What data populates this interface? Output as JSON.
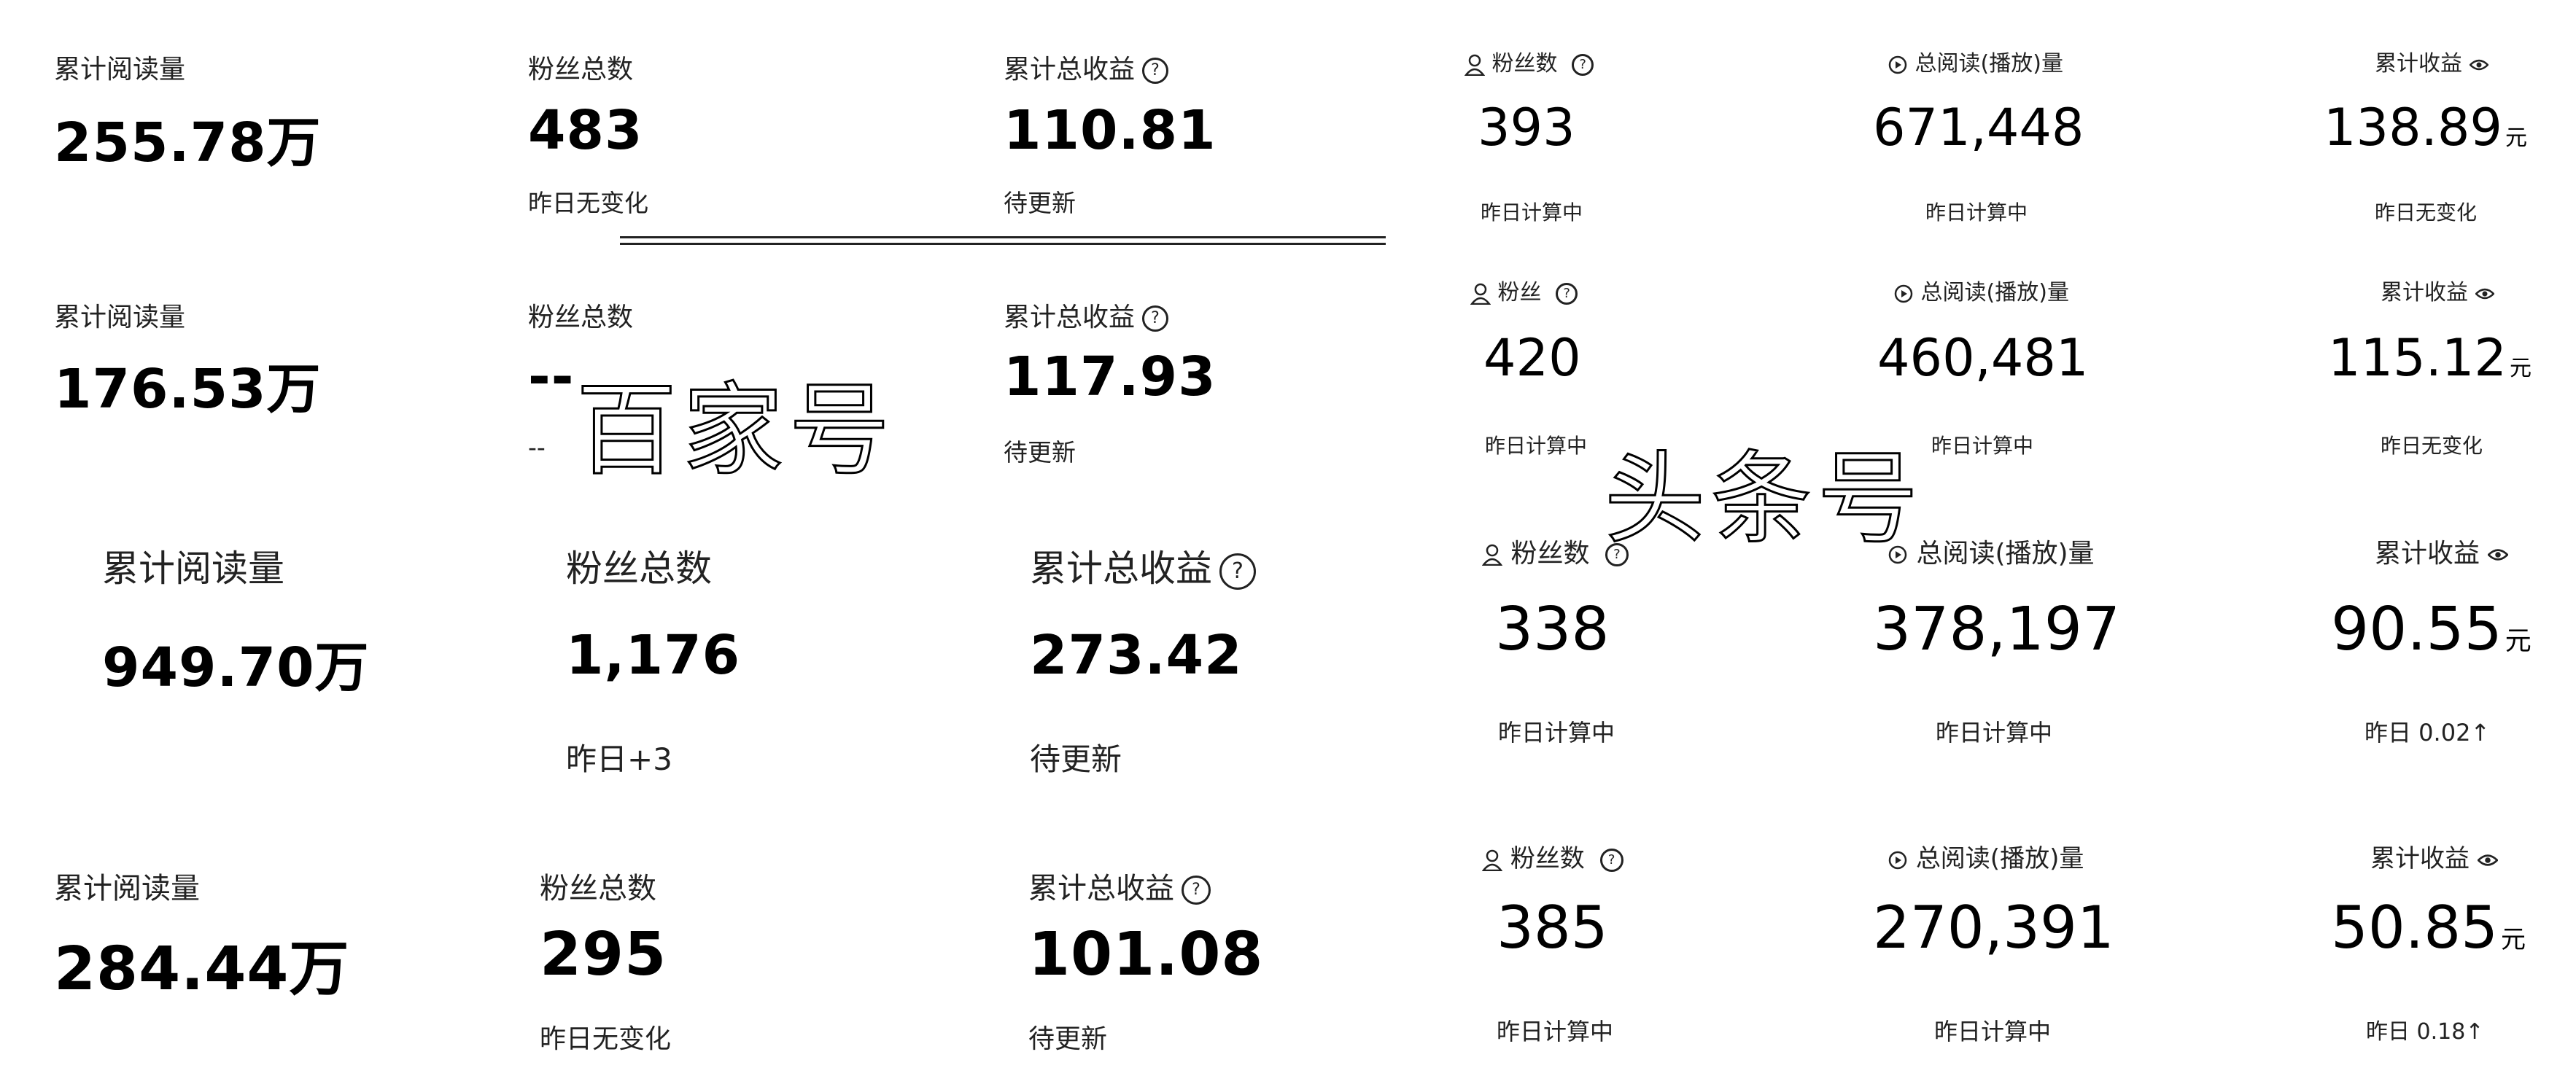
{
  "watermarks": {
    "left": "百家号",
    "right": "头条号"
  },
  "baijiahao_cards": [
    {
      "read_label": "累计阅读量",
      "read_value": "255.78万",
      "fans_label": "粉丝总数",
      "fans_value": "483",
      "fans_sub": "昨日无变化",
      "income_label": "累计总收益",
      "income_value": "110.81",
      "income_sub": "待更新"
    },
    {
      "read_label": "累计阅读量",
      "read_value": "176.53万",
      "fans_label": "粉丝总数",
      "fans_value": "--",
      "fans_sub": "--",
      "income_label": "累计总收益",
      "income_value": "117.93",
      "income_sub": "待更新"
    },
    {
      "read_label": "累计阅读量",
      "read_value": "949.70万",
      "fans_label": "粉丝总数",
      "fans_value": "1,176",
      "fans_sub": "昨日+3",
      "income_label": "累计总收益",
      "income_value": "273.42",
      "income_sub": "待更新"
    },
    {
      "read_label": "累计阅读量",
      "read_value": "284.44万",
      "fans_label": "粉丝总数",
      "fans_value": "295",
      "fans_sub": "昨日无变化",
      "income_label": "累计总收益",
      "income_value": "101.08",
      "income_sub": "待更新"
    }
  ],
  "toutiao_cards": [
    {
      "fans_label": "粉丝数",
      "fans_value": "393",
      "fans_sub": "昨日计算中",
      "read_label": "总阅读(播放)量",
      "read_value": "671,448",
      "read_sub": "昨日计算中",
      "income_label": "累计收益",
      "income_value": "138.89",
      "income_unit": "元",
      "income_sub": "昨日无变化"
    },
    {
      "fans_label": "粉丝",
      "fans_value": "420",
      "fans_sub": "昨日计算中",
      "read_label": "总阅读(播放)量",
      "read_value": "460,481",
      "read_sub": "昨日计算中",
      "income_label": "累计收益",
      "income_value": "115.12",
      "income_unit": "元",
      "income_sub": "昨日无变化"
    },
    {
      "fans_label": "粉丝数",
      "fans_value": "338",
      "fans_sub": "昨日计算中",
      "read_label": "总阅读(播放)量",
      "read_value": "378,197",
      "read_sub": "昨日计算中",
      "income_label": "累计收益",
      "income_value": "90.55",
      "income_unit": "元",
      "income_sub": "昨日 0.02↑"
    },
    {
      "fans_label": "粉丝数",
      "fans_value": "385",
      "fans_sub": "昨日计算中",
      "read_label": "总阅读(播放)量",
      "read_value": "270,391",
      "read_sub": "昨日计算中",
      "income_label": "累计收益",
      "income_value": "50.85",
      "income_unit": "元",
      "income_sub": "昨日 0.18↑"
    }
  ],
  "icons": {
    "question": "question-circle-icon",
    "person": "person-icon",
    "reads": "play-circle-icon",
    "eye": "eye-icon"
  }
}
